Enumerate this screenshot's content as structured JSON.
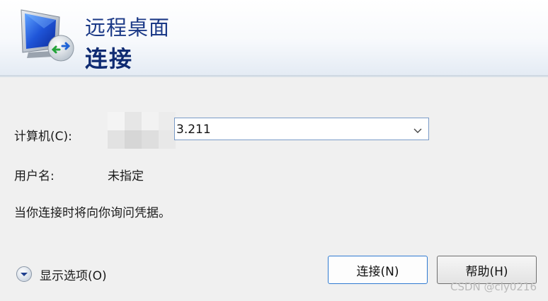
{
  "header": {
    "title": "远程桌面",
    "subtitle": "连接",
    "icon": "remote-desktop-monitor-icon"
  },
  "form": {
    "computer_label": "计算机(C):",
    "computer_value": "3.211",
    "username_label": "用户名:",
    "username_value": "未指定",
    "info_text": "当你连接时将向你询问凭据。"
  },
  "footer": {
    "options_label": "显示选项(O)",
    "connect_label": "连接(N)",
    "help_label": "帮助(H)"
  },
  "watermark": "CSDN @cly0216",
  "colors": {
    "accent": "#2f7ad1",
    "title": "#1c3a87",
    "background": "#f0f0f0"
  }
}
